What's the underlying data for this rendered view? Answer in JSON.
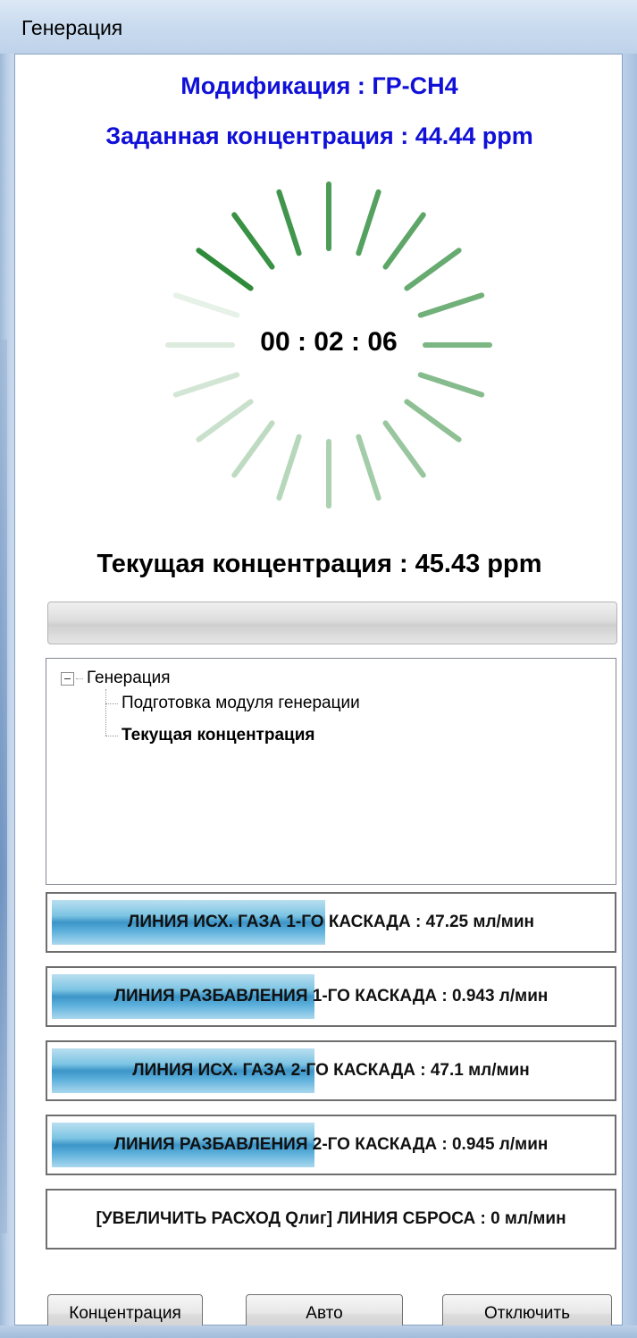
{
  "window": {
    "title": "Генерация"
  },
  "header": {
    "modification": "Модификация : ГР-СН4",
    "target_concentration": "Заданная концентрация : 44.44 ppm"
  },
  "timer": {
    "value": "00 : 02 : 06"
  },
  "current_concentration": "Текущая концентрация : 45.43 ppm",
  "progress": {
    "fraction": 0
  },
  "tree": {
    "root": "Генерация",
    "children": [
      {
        "label": "Подготовка модуля генерации",
        "bold": false
      },
      {
        "label": "Текущая концентрация",
        "bold": true
      }
    ]
  },
  "lines": [
    {
      "label": "ЛИНИЯ ИСХ. ГАЗА 1-ГО КАСКАДА : 47.25 мл/мин",
      "fill": 0.49
    },
    {
      "label": "ЛИНИЯ РАЗБАВЛЕНИЯ 1-ГО КАСКАДА : 0.943 л/мин",
      "fill": 0.47
    },
    {
      "label": "ЛИНИЯ ИСХ. ГАЗА 2-ГО КАСКАДА : 47.1 мл/мин",
      "fill": 0.47
    },
    {
      "label": "ЛИНИЯ РАЗБАВЛЕНИЯ 2-ГО КАСКАДА : 0.945 л/мин",
      "fill": 0.47
    },
    {
      "label": "[УВЕЛИЧИТЬ РАСХОД Qлиг] ЛИНИЯ СБРОСА : 0 мл/мин",
      "fill": 0
    }
  ],
  "buttons": {
    "concentration": "Концентрация",
    "auto": "Авто",
    "off": "Отключить"
  },
  "colors": {
    "heading": "#1010d8",
    "spinner": "#2e8b3a",
    "line_fill": "#3c95c8"
  }
}
